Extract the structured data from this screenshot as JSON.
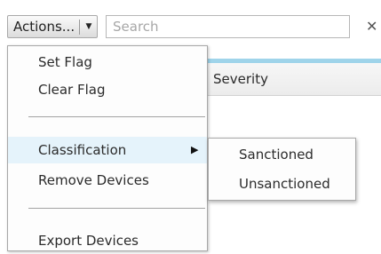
{
  "toolbar": {
    "actions_label": "Actions...",
    "search_placeholder": "Search",
    "search_value": "",
    "clear_glyph": "✕"
  },
  "grid": {
    "columns": [
      "Severity"
    ]
  },
  "menu": {
    "items": [
      {
        "label": "Set Flag"
      },
      {
        "label": "Clear Flag"
      },
      {
        "label": "Classification",
        "has_submenu": true,
        "highlighted": true
      },
      {
        "label": "Remove Devices"
      },
      {
        "label": "Export Devices"
      }
    ],
    "submenu_glyph": "▶"
  },
  "submenu": {
    "items": [
      {
        "label": "Sanctioned"
      },
      {
        "label": "Unsanctioned"
      }
    ]
  },
  "colors": {
    "highlight": "#e5f3fb",
    "grid_accent": "#9fd4ea",
    "border": "#a8a8a8"
  }
}
